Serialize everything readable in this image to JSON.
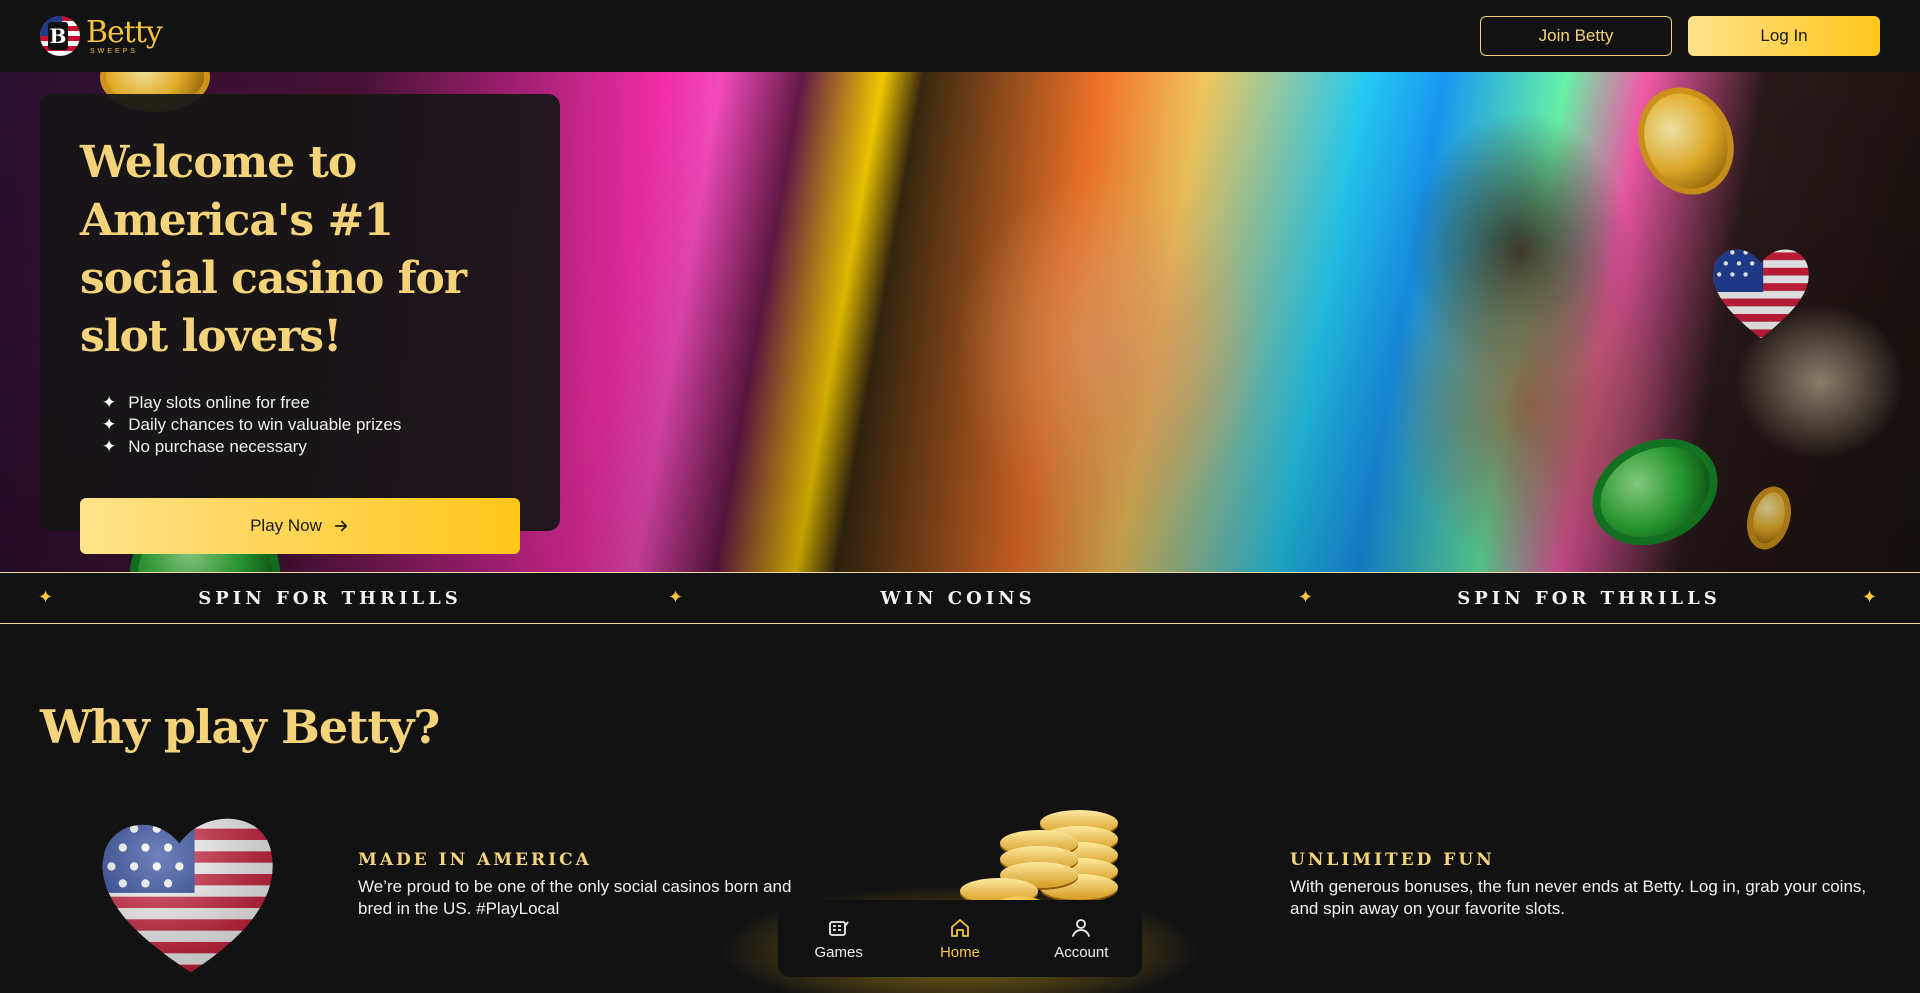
{
  "header": {
    "logo": {
      "name": "Betty",
      "sub": "SWEEPS"
    },
    "join_label": "Join Betty",
    "login_label": "Log In"
  },
  "hero": {
    "title": "Welcome to America's #1 social casino for slot lovers!",
    "bullets": [
      "Play slots online for free",
      "Daily chances to win valuable prizes",
      "No purchase necessary"
    ],
    "bullet_icon": "sparkle-icon",
    "cta_label": "Play Now",
    "cta_icon": "arrow-right-icon"
  },
  "ticker": {
    "items": [
      "SPIN FOR THRILLS",
      "WIN COINS",
      "SPIN FOR THRILLS"
    ],
    "separator_icon": "sparkle-icon"
  },
  "why": {
    "title": "Why play Betty?",
    "features": [
      {
        "label": "MADE IN AMERICA",
        "text": "We’re proud to be one of the only social casinos born and bred in the US. #PlayLocal",
        "icon": "american-flag-heart-icon"
      },
      {
        "label": "UNLIMITED FUN",
        "text": "With generous bonuses, the fun never ends at Betty. Log in, grab your coins, and spin away on your favorite slots.",
        "icon": "coin-stack-icon"
      }
    ]
  },
  "bottom_nav": {
    "items": [
      {
        "label": "Games",
        "icon": "slot-machine-icon",
        "active": false
      },
      {
        "label": "Home",
        "icon": "home-icon",
        "active": true
      },
      {
        "label": "Account",
        "icon": "user-icon",
        "active": false
      }
    ]
  },
  "colors": {
    "accent": "#f5c542",
    "accent_light": "#ffe28a",
    "background": "#121212",
    "card": "#161616"
  }
}
